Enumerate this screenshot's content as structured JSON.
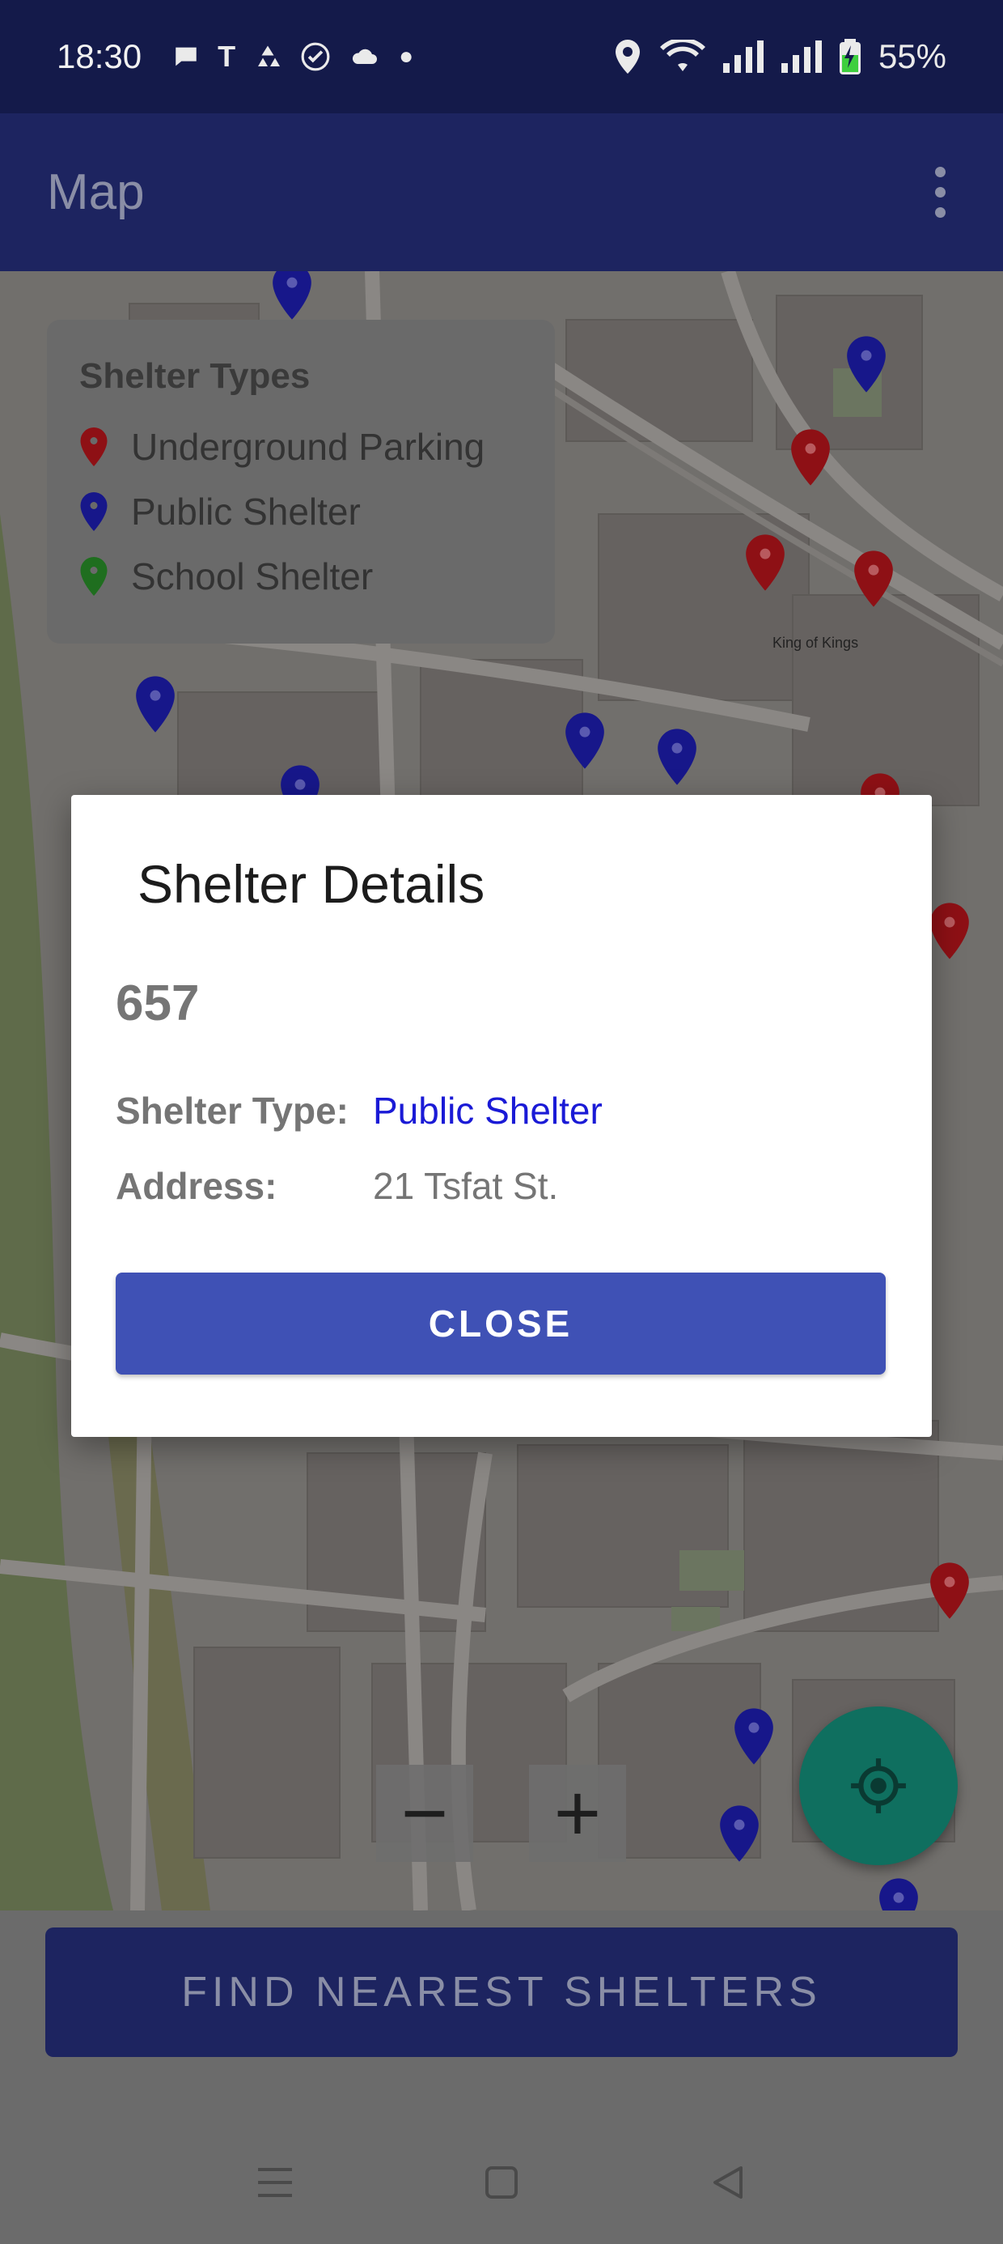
{
  "status_bar": {
    "time": "18:30",
    "battery": "55%",
    "left_icons": [
      "chat-bubble-icon",
      "t-icon",
      "recycle-icon",
      "check-circle-icon",
      "cloud-icon",
      "dot-icon"
    ],
    "right_icons": [
      "location-icon",
      "wifi-icon",
      "signal-icon",
      "signal-icon",
      "battery-charging-icon"
    ]
  },
  "app_bar": {
    "title": "Map",
    "menu_icon": "more-vert-icon"
  },
  "legend": {
    "title": "Shelter Types",
    "items": [
      {
        "label": "Underground Parking",
        "color": "#b3131b"
      },
      {
        "label": "Public Shelter",
        "color": "#1a1ab0"
      },
      {
        "label": "School Shelter",
        "color": "#2e9e2e"
      }
    ]
  },
  "map": {
    "zoom_out": "−",
    "zoom_in": "+",
    "locate_icon": "my-location-icon",
    "place_labels": [
      "King of Kings"
    ]
  },
  "dialog": {
    "title": "Shelter Details",
    "id": "657",
    "type_label": "Shelter Type:",
    "type_value": "Public Shelter",
    "address_label": "Address:",
    "address_value": "21 Tsfat St.",
    "close_label": "CLOSE"
  },
  "find_button": {
    "label": "FIND NEAREST SHELTERS"
  },
  "nav": {
    "recents_icon": "menu-icon",
    "home_icon": "home-square-icon",
    "back_icon": "back-triangle-icon"
  },
  "colors": {
    "primary": "#3f51b5",
    "primary_dark": "#1d2460",
    "accent": "#0f6f5f",
    "public_shelter_text": "#1a1ad6"
  }
}
